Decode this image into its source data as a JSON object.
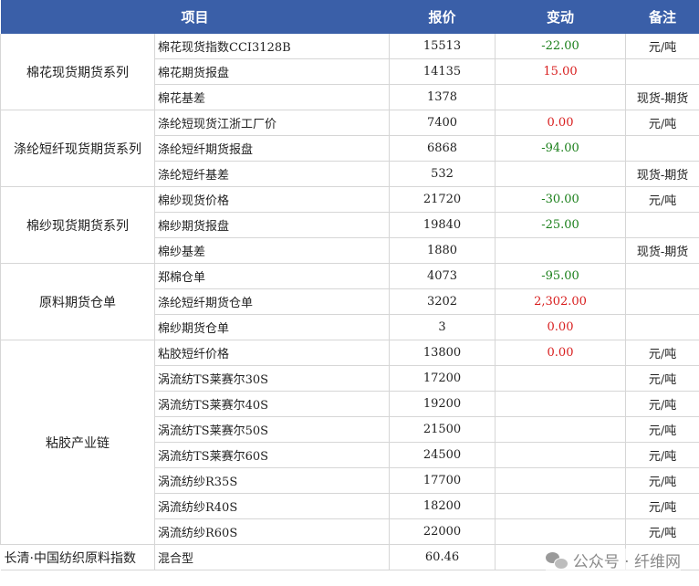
{
  "header": {
    "item": "项目",
    "price": "报价",
    "change": "变动",
    "note": "备注"
  },
  "rows": [
    {
      "category": "棉花现货期货系列",
      "item": "棉花现货指数CCI3128B",
      "price": "15513",
      "change": "-22.00",
      "note": "元/吨"
    },
    {
      "item": "棉花期货报盘",
      "price": "14135",
      "change": "15.00",
      "note": ""
    },
    {
      "item": "棉花基差",
      "price": "1378",
      "change": "",
      "note": "现货-期货"
    },
    {
      "category": "涤纶短纤现货期货系列",
      "item": "涤纶短现货江浙工厂价",
      "price": "7400",
      "change": "0.00",
      "note": "元/吨"
    },
    {
      "item": "涤纶短纤期货报盘",
      "price": "6868",
      "change": "-94.00",
      "note": ""
    },
    {
      "item": "涤纶短纤基差",
      "price": "532",
      "change": "",
      "note": "现货-期货"
    },
    {
      "category": "棉纱现货期货系列",
      "item": "棉纱现货价格",
      "price": "21720",
      "change": "-30.00",
      "note": "元/吨"
    },
    {
      "item": "棉纱期货报盘",
      "price": "19840",
      "change": "-25.00",
      "note": ""
    },
    {
      "item": "棉纱基差",
      "price": "1880",
      "change": "",
      "note": "现货-期货"
    },
    {
      "category": "原料期货仓单",
      "item": "郑棉仓单",
      "price": "4073",
      "change": "-95.00",
      "note": ""
    },
    {
      "item": "涤纶短纤期货仓单",
      "price": "3202",
      "change": "2,302.00",
      "note": ""
    },
    {
      "item": "棉纱期货仓单",
      "price": "3",
      "change": "0.00",
      "note": ""
    },
    {
      "category": "粘胶产业链",
      "item": "粘胶短纤价格",
      "price": "13800",
      "change": "0.00",
      "note": "元/吨"
    },
    {
      "item": "涡流纺TS莱赛尔30S",
      "price": "17200",
      "change": "",
      "note": "元/吨"
    },
    {
      "item": "涡流纺TS莱赛尔40S",
      "price": "19200",
      "change": "",
      "note": "元/吨"
    },
    {
      "item": "涡流纺TS莱赛尔50S",
      "price": "21500",
      "change": "",
      "note": "元/吨"
    },
    {
      "item": "涡流纺TS莱赛尔60S",
      "price": "24500",
      "change": "",
      "note": "元/吨"
    },
    {
      "item": "涡流纺纱R35S",
      "price": "17700",
      "change": "",
      "note": "元/吨"
    },
    {
      "item": "涡流纺纱R40S",
      "price": "18200",
      "change": "",
      "note": "元/吨"
    },
    {
      "item": "涡流纺纱R60S",
      "price": "22000",
      "change": "",
      "note": "元/吨"
    }
  ],
  "footer": {
    "label": "长清·中国纺织原料指数",
    "item": "混合型",
    "price": "60.46"
  },
  "watermark": {
    "text": "公众号 · 纤维网",
    "icon": "wechat-icon"
  },
  "colors": {
    "header_bg": "#3a5fa8",
    "negative": "#1a7f1a",
    "positive": "#d81e1e"
  }
}
